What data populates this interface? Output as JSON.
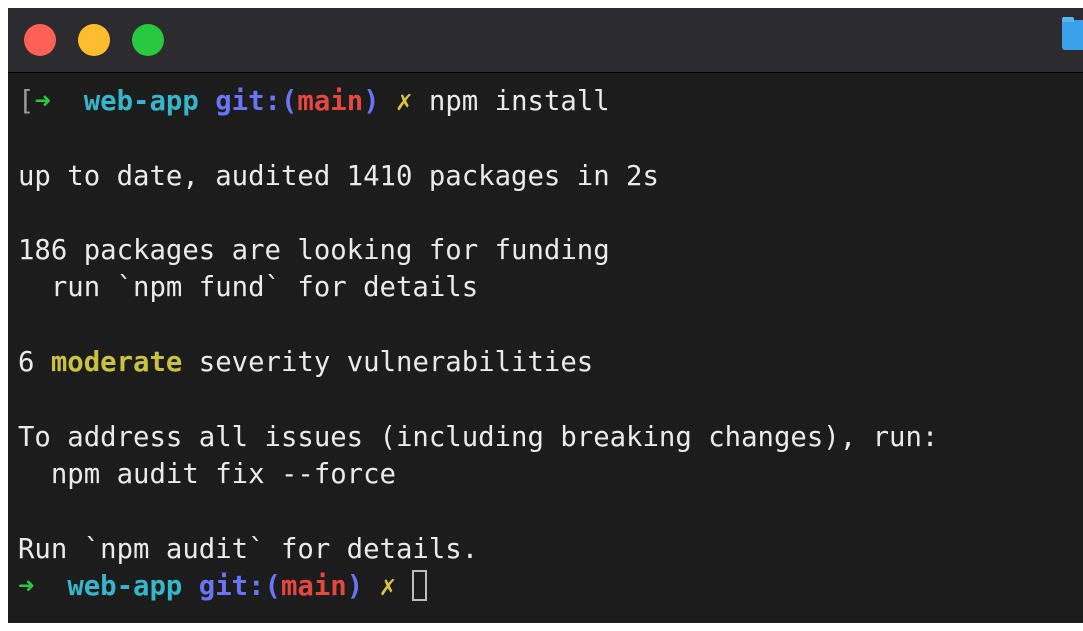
{
  "window": {
    "controls": [
      "close",
      "minimize",
      "zoom"
    ],
    "colors": {
      "background": "#1c1c1c",
      "titlebar": "#2c2c2e",
      "close": "#fe5f57",
      "minimize": "#febc2e",
      "zoom": "#28c840"
    }
  },
  "prompt": {
    "open_bracket": "[",
    "arrow": "➜",
    "directory": "web-app",
    "git_prefix": "git:(",
    "branch": "main",
    "git_suffix": ")",
    "dirty_marker": "✗",
    "colors": {
      "arrow": "#29c940",
      "directory": "#36b7c9",
      "git": "#6a74f6",
      "branch": "#e5473f",
      "dirty": "#d7c53c"
    }
  },
  "command": "npm install",
  "output": {
    "audit_summary": "up to date, audited 1410 packages in 2s",
    "funding_line": "186 packages are looking for funding",
    "funding_hint": "  run `npm fund` for details",
    "vuln_count": "6",
    "vuln_severity": "moderate",
    "vuln_suffix": "severity vulnerabilities",
    "fix_intro": "To address all issues (including breaking changes), run:",
    "fix_command": "  npm audit fix --force",
    "details_hint": "Run `npm audit` for details."
  }
}
